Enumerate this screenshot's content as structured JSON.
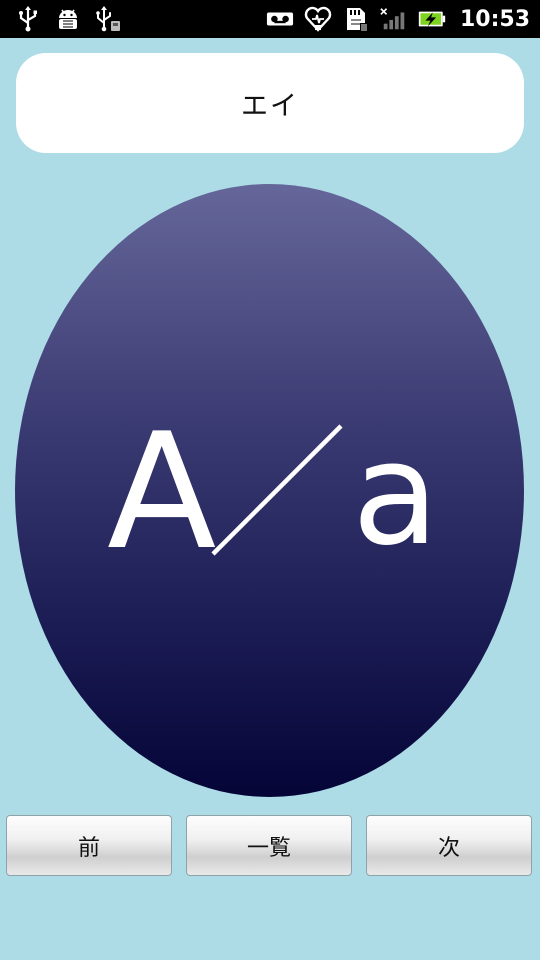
{
  "status_bar": {
    "left_icons": [
      "usb-icon",
      "android-debug-icon",
      "usb-storage-icon"
    ],
    "right_icons": [
      "voicemail-icon",
      "heart-app-icon",
      "sd-card-icon",
      "signal-no-service-icon",
      "battery-charging-icon"
    ],
    "time": "10:53"
  },
  "reading": {
    "text": "エイ"
  },
  "letter": {
    "uppercase": "A",
    "lowercase": "a",
    "colors": {
      "oval_top": "#656699",
      "oval_bottom": "#040437",
      "letter": "#ffffff"
    }
  },
  "nav": {
    "prev_label": "前",
    "list_label": "一覧",
    "next_label": "次"
  },
  "colors": {
    "background": "#ADDCE7",
    "card": "#ffffff"
  }
}
